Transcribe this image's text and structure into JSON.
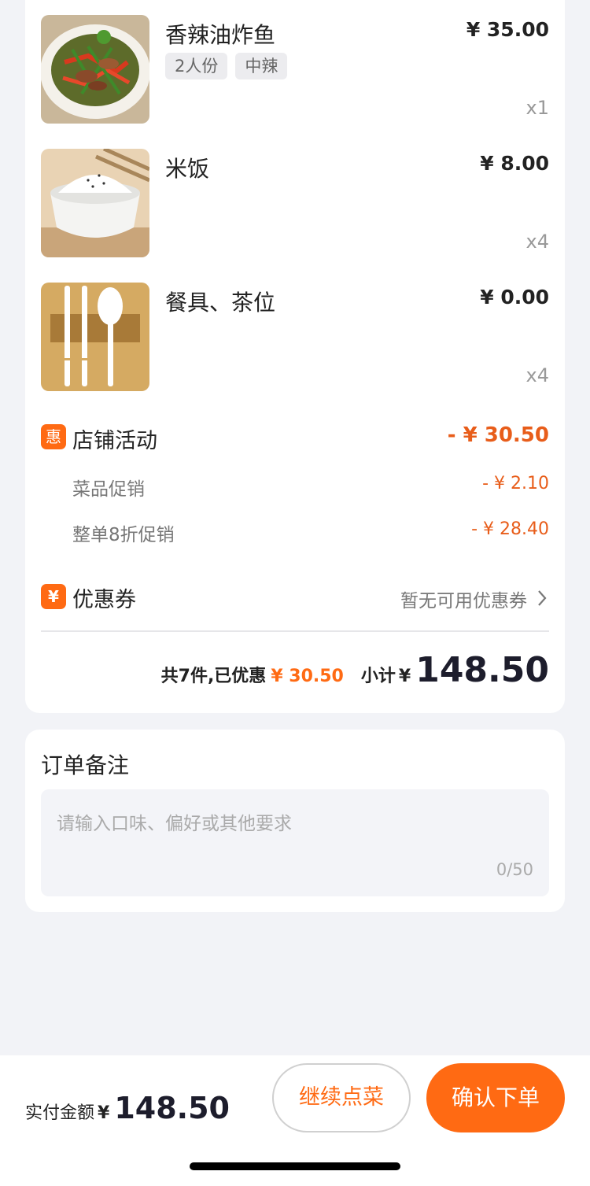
{
  "order": {
    "items": [
      {
        "name": "香辣油炸鱼",
        "price": "¥ 35.00",
        "qty": "x1",
        "tags": [
          "2人份",
          "中辣"
        ],
        "image": "spicy-fried-fish-photo"
      },
      {
        "name": "米饭",
        "price": "¥ 8.00",
        "qty": "x4",
        "tags": [],
        "image": "rice-bowl-photo"
      },
      {
        "name": "餐具、茶位",
        "price": "¥ 0.00",
        "qty": "x4",
        "tags": [],
        "image": "utensils-icon"
      }
    ],
    "activity": {
      "icon": "惠",
      "label": "店铺活动",
      "amount": "- ¥ 30.50",
      "details": [
        {
          "label": "菜品促销",
          "amount": "- ¥ 2.10"
        },
        {
          "label": "整单8折促销",
          "amount": "- ¥ 28.40"
        }
      ]
    },
    "coupon": {
      "icon": "¥",
      "label": "优惠券",
      "status": "暂无可用优惠券"
    },
    "summary": {
      "count_text": "共7件,已优惠",
      "discount": "¥ 30.50",
      "subtotal_label": "小计",
      "currency": "¥",
      "subtotal": "148.50"
    }
  },
  "remark": {
    "title": "订单备注",
    "placeholder": "请输入口味、偏好或其他要求",
    "counter": "0/50"
  },
  "footer": {
    "pay_label": "实付金额",
    "currency": "¥",
    "pay_amount": "148.50",
    "continue_label": "继续点菜",
    "confirm_label": "确认下单"
  },
  "colors": {
    "accent": "#ff6a13",
    "discount": "#e85d1a",
    "background": "#f2f3f7"
  }
}
